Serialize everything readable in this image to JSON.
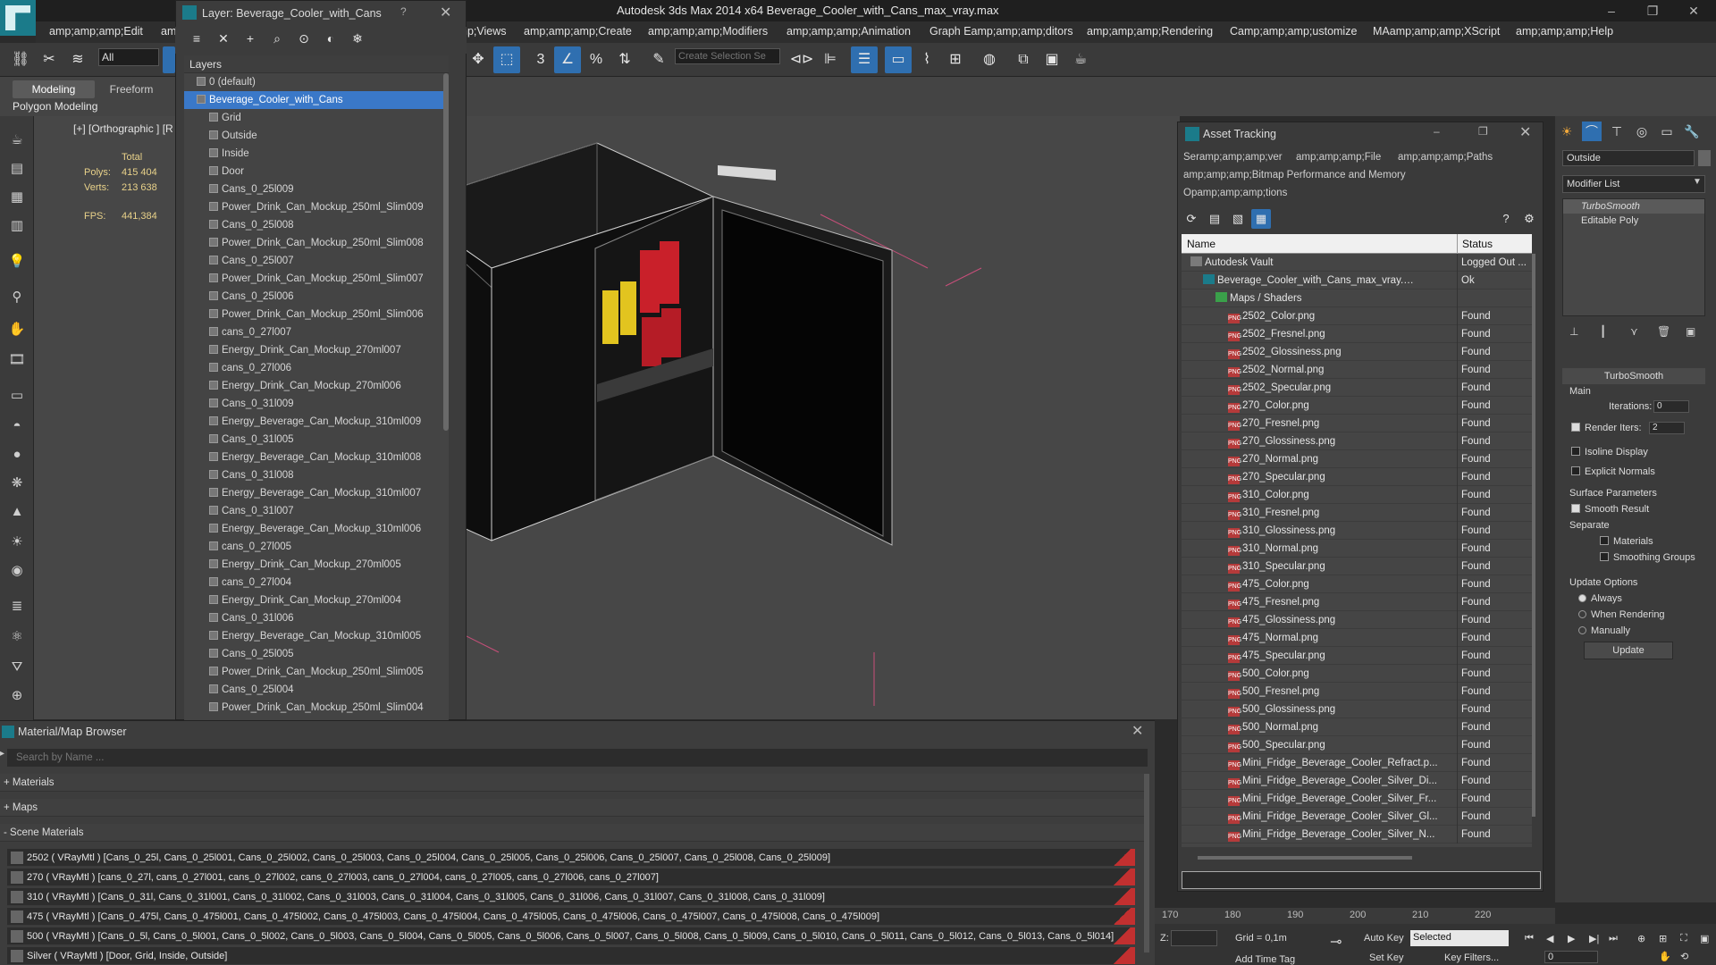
{
  "app": {
    "title": "Autodesk 3ds Max  2014 x64     Beverage_Cooler_with_Cans_max_vray.max",
    "menus": [
      "amp;amp;amp;Edit",
      "amp",
      "amp;amp;amp;Views",
      "amp;amp;amp;Create",
      "amp;amp;amp;Modifiers",
      "amp;amp;amp;Animation",
      "Graph Eamp;amp;amp;ditors",
      "amp;amp;amp;Rendering",
      "Camp;amp;amp;ustomize",
      "MAamp;amp;amp;XScript",
      "amp;amp;amp;Help"
    ],
    "window_buttons": [
      "–",
      "❐",
      "✕"
    ]
  },
  "toolbar": {
    "selection_filter": "All",
    "selection_set_placeholder": "Create Selection Se",
    "snap_labels": [
      "3",
      "%"
    ]
  },
  "ribbon": {
    "tabs": [
      "Modeling",
      "Freeform"
    ],
    "sub_label": "Polygon Modeling"
  },
  "viewport": {
    "label": "[+] [Orthographic ] [R",
    "stats": {
      "header": "Total",
      "polys_label": "Polys:",
      "polys_value": "415 404",
      "verts_label": "Verts:",
      "verts_value": "213 638",
      "fps_label": "FPS:",
      "fps_value": "441,384"
    }
  },
  "layer_panel": {
    "title": "Layer: Beverage_Cooler_with_Cans",
    "help": "?",
    "header": "Layers",
    "layers": [
      {
        "name": "0 (default)",
        "level": 0
      },
      {
        "name": "Beverage_Cooler_with_Cans",
        "level": 0,
        "selected": true
      },
      {
        "name": "Grid",
        "level": 1
      },
      {
        "name": "Outside",
        "level": 1
      },
      {
        "name": "Inside",
        "level": 1
      },
      {
        "name": "Door",
        "level": 1
      },
      {
        "name": "Cans_0_25l009",
        "level": 1
      },
      {
        "name": "Power_Drink_Can_Mockup_250ml_Slim009",
        "level": 1
      },
      {
        "name": "Cans_0_25l008",
        "level": 1
      },
      {
        "name": "Power_Drink_Can_Mockup_250ml_Slim008",
        "level": 1
      },
      {
        "name": "Cans_0_25l007",
        "level": 1
      },
      {
        "name": "Power_Drink_Can_Mockup_250ml_Slim007",
        "level": 1
      },
      {
        "name": "Cans_0_25l006",
        "level": 1
      },
      {
        "name": "Power_Drink_Can_Mockup_250ml_Slim006",
        "level": 1
      },
      {
        "name": "cans_0_27l007",
        "level": 1
      },
      {
        "name": "Energy_Drink_Can_Mockup_270ml007",
        "level": 1
      },
      {
        "name": "cans_0_27l006",
        "level": 1
      },
      {
        "name": "Energy_Drink_Can_Mockup_270ml006",
        "level": 1
      },
      {
        "name": "Cans_0_31l009",
        "level": 1
      },
      {
        "name": "Energy_Beverage_Can_Mockup_310ml009",
        "level": 1
      },
      {
        "name": "Cans_0_31l005",
        "level": 1
      },
      {
        "name": "Energy_Beverage_Can_Mockup_310ml008",
        "level": 1
      },
      {
        "name": "Cans_0_31l008",
        "level": 1
      },
      {
        "name": "Energy_Beverage_Can_Mockup_310ml007",
        "level": 1
      },
      {
        "name": "Cans_0_31l007",
        "level": 1
      },
      {
        "name": "Energy_Beverage_Can_Mockup_310ml006",
        "level": 1
      },
      {
        "name": "cans_0_27l005",
        "level": 1
      },
      {
        "name": "Energy_Drink_Can_Mockup_270ml005",
        "level": 1
      },
      {
        "name": "cans_0_27l004",
        "level": 1
      },
      {
        "name": "Energy_Drink_Can_Mockup_270ml004",
        "level": 1
      },
      {
        "name": "Cans_0_31l006",
        "level": 1
      },
      {
        "name": "Energy_Beverage_Can_Mockup_310ml005",
        "level": 1
      },
      {
        "name": "Cans_0_25l005",
        "level": 1
      },
      {
        "name": "Power_Drink_Can_Mockup_250ml_Slim005",
        "level": 1
      },
      {
        "name": "Cans_0_25l004",
        "level": 1
      },
      {
        "name": "Power_Drink_Can_Mockup_250ml_Slim004",
        "level": 1
      }
    ]
  },
  "asset_tracking": {
    "title": "Asset Tracking",
    "menu_line1": [
      "Seramp;amp;amp;ver",
      "amp;amp;amp;File",
      "amp;amp;amp;Paths"
    ],
    "menu_line2": "amp;amp;amp;Bitmap Performance and Memory",
    "menu_line3": "Opamp;amp;amp;tions",
    "col_name": "Name",
    "col_status": "Status",
    "rows": [
      {
        "name": "Autodesk Vault",
        "status": "Logged Out ...",
        "level": 0,
        "kind": "vault"
      },
      {
        "name": "Beverage_Cooler_with_Cans_max_vray.max",
        "status": "Ok",
        "level": 1,
        "kind": "max"
      },
      {
        "name": "Maps / Shaders",
        "status": "",
        "level": 2,
        "kind": "folder"
      },
      {
        "name": "2502_Color.png",
        "status": "Found",
        "level": 3,
        "kind": "png"
      },
      {
        "name": "2502_Fresnel.png",
        "status": "Found",
        "level": 3,
        "kind": "png"
      },
      {
        "name": "2502_Glossiness.png",
        "status": "Found",
        "level": 3,
        "kind": "png"
      },
      {
        "name": "2502_Normal.png",
        "status": "Found",
        "level": 3,
        "kind": "png"
      },
      {
        "name": "2502_Specular.png",
        "status": "Found",
        "level": 3,
        "kind": "png"
      },
      {
        "name": "270_Color.png",
        "status": "Found",
        "level": 3,
        "kind": "png"
      },
      {
        "name": "270_Fresnel.png",
        "status": "Found",
        "level": 3,
        "kind": "png"
      },
      {
        "name": "270_Glossiness.png",
        "status": "Found",
        "level": 3,
        "kind": "png"
      },
      {
        "name": "270_Normal.png",
        "status": "Found",
        "level": 3,
        "kind": "png"
      },
      {
        "name": "270_Specular.png",
        "status": "Found",
        "level": 3,
        "kind": "png"
      },
      {
        "name": "310_Color.png",
        "status": "Found",
        "level": 3,
        "kind": "png"
      },
      {
        "name": "310_Fresnel.png",
        "status": "Found",
        "level": 3,
        "kind": "png"
      },
      {
        "name": "310_Glossiness.png",
        "status": "Found",
        "level": 3,
        "kind": "png"
      },
      {
        "name": "310_Normal.png",
        "status": "Found",
        "level": 3,
        "kind": "png"
      },
      {
        "name": "310_Specular.png",
        "status": "Found",
        "level": 3,
        "kind": "png"
      },
      {
        "name": "475_Color.png",
        "status": "Found",
        "level": 3,
        "kind": "png"
      },
      {
        "name": "475_Fresnel.png",
        "status": "Found",
        "level": 3,
        "kind": "png"
      },
      {
        "name": "475_Glossiness.png",
        "status": "Found",
        "level": 3,
        "kind": "png"
      },
      {
        "name": "475_Normal.png",
        "status": "Found",
        "level": 3,
        "kind": "png"
      },
      {
        "name": "475_Specular.png",
        "status": "Found",
        "level": 3,
        "kind": "png"
      },
      {
        "name": "500_Color.png",
        "status": "Found",
        "level": 3,
        "kind": "png"
      },
      {
        "name": "500_Fresnel.png",
        "status": "Found",
        "level": 3,
        "kind": "png"
      },
      {
        "name": "500_Glossiness.png",
        "status": "Found",
        "level": 3,
        "kind": "png"
      },
      {
        "name": "500_Normal.png",
        "status": "Found",
        "level": 3,
        "kind": "png"
      },
      {
        "name": "500_Specular.png",
        "status": "Found",
        "level": 3,
        "kind": "png"
      },
      {
        "name": "Mini_Fridge_Beverage_Cooler_Refract.p...",
        "status": "Found",
        "level": 3,
        "kind": "png"
      },
      {
        "name": "Mini_Fridge_Beverage_Cooler_Silver_Di...",
        "status": "Found",
        "level": 3,
        "kind": "png"
      },
      {
        "name": "Mini_Fridge_Beverage_Cooler_Silver_Fr...",
        "status": "Found",
        "level": 3,
        "kind": "png"
      },
      {
        "name": "Mini_Fridge_Beverage_Cooler_Silver_Gl...",
        "status": "Found",
        "level": 3,
        "kind": "png"
      },
      {
        "name": "Mini_Fridge_Beverage_Cooler_Silver_N...",
        "status": "Found",
        "level": 3,
        "kind": "png"
      }
    ]
  },
  "command_panel": {
    "object_name": "Outside",
    "modifier_list": "Modifier List",
    "stack": [
      "TurboSmooth",
      "Editable Poly"
    ],
    "turbosmooth": {
      "title": "TurboSmooth",
      "main": "Main",
      "iterations_label": "Iterations:",
      "iterations_value": "0",
      "render_iters_label": "Render Iters:",
      "render_iters_value": "2",
      "isoline": "Isoline Display",
      "explicit_normals": "Explicit Normals",
      "surface_params": "Surface Parameters",
      "smooth_result": "Smooth Result",
      "separate": "Separate",
      "materials": "Materials",
      "smoothing_groups": "Smoothing Groups",
      "update_options": "Update Options",
      "always": "Always",
      "when_rendering": "When Rendering",
      "manually": "Manually",
      "update_button": "Update"
    }
  },
  "material_browser": {
    "title": "Material/Map Browser",
    "search_placeholder": "Search by Name ...",
    "groups": [
      "+ Materials",
      "+ Maps",
      "- Scene Materials"
    ],
    "materials": [
      "2502 ( VRayMtl ) [Cans_0_25l, Cans_0_25l001, Cans_0_25l002, Cans_0_25l003, Cans_0_25l004, Cans_0_25l005, Cans_0_25l006, Cans_0_25l007, Cans_0_25l008, Cans_0_25l009]",
      "270 ( VRayMtl ) [cans_0_27l, cans_0_27l001, cans_0_27l002, cans_0_27l003, cans_0_27l004, cans_0_27l005, cans_0_27l006, cans_0_27l007]",
      "310 ( VRayMtl ) [Cans_0_31l, Cans_0_31l001, Cans_0_31l002, Cans_0_31l003, Cans_0_31l004, Cans_0_31l005, Cans_0_31l006, Cans_0_31l007, Cans_0_31l008, Cans_0_31l009]",
      "475 ( VRayMtl ) [Cans_0_475l, Cans_0_475l001, Cans_0_475l002, Cans_0_475l003, Cans_0_475l004, Cans_0_475l005, Cans_0_475l006, Cans_0_475l007, Cans_0_475l008, Cans_0_475l009]",
      "500 ( VRayMtl ) [Cans_0_5l, Cans_0_5l001, Cans_0_5l002, Cans_0_5l003, Cans_0_5l004, Cans_0_5l005, Cans_0_5l006, Cans_0_5l007, Cans_0_5l008, Cans_0_5l009, Cans_0_5l010, Cans_0_5l011, Cans_0_5l012, Cans_0_5l013, Cans_0_5l014]",
      "Silver ( VRayMtl ) [Door, Grid, Inside, Outside]"
    ]
  },
  "timeline": {
    "ticks": [
      "170",
      "180",
      "190",
      "200",
      "210",
      "220"
    ]
  },
  "status_bar": {
    "z_label": "Z:",
    "grid": "Grid = 0,1m",
    "auto_key": "Auto Key",
    "selected": "Selected",
    "set_key": "Set Key",
    "key_filters": "Key Filters...",
    "add_time_tag": "Add Time Tag",
    "frame": "0"
  }
}
